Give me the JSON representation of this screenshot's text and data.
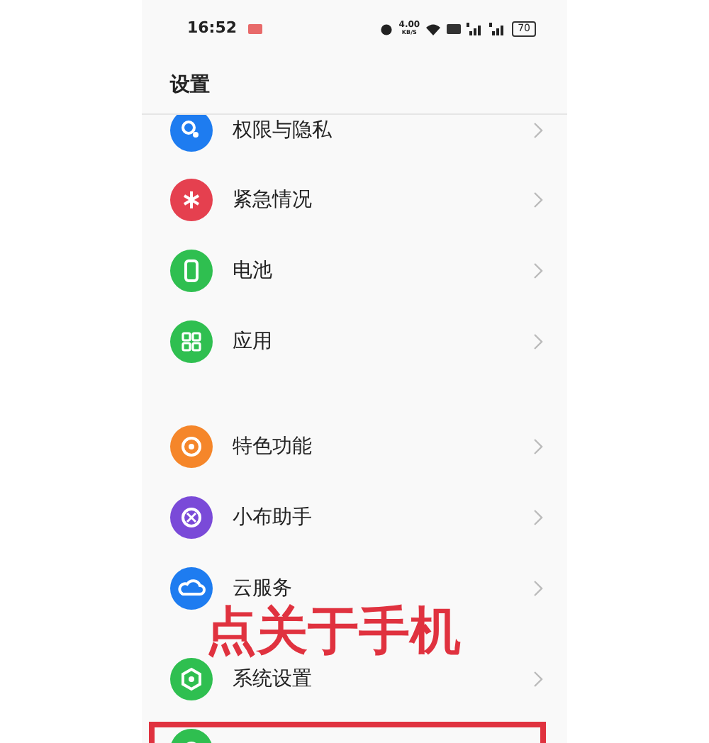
{
  "status_bar": {
    "time": "16:52",
    "speed": "4.00",
    "speed_unit": "KB/S",
    "battery": "70"
  },
  "title": "设置",
  "groups": [
    {
      "items": [
        {
          "label": "权限与隐私",
          "color": "#1e7cf0",
          "highlighted": false
        },
        {
          "label": "紧急情况",
          "color": "#e5404f",
          "highlighted": false
        },
        {
          "label": "电池",
          "color": "#2fbf50",
          "highlighted": false
        },
        {
          "label": "应用",
          "color": "#2fbf50",
          "highlighted": false
        }
      ]
    },
    {
      "items": [
        {
          "label": "特色功能",
          "color": "#f5862a",
          "highlighted": false
        },
        {
          "label": "小布助手",
          "color": "#7a4ad8",
          "highlighted": false
        },
        {
          "label": "云服务",
          "color": "#1e7cf0",
          "highlighted": false
        }
      ]
    },
    {
      "items": [
        {
          "label": "系统设置",
          "color": "#2fbf50",
          "highlighted": false
        },
        {
          "color": "#2fbf50",
          "highlighted": true
        }
      ]
    }
  ],
  "annotation": {
    "text": "点关于手机"
  }
}
